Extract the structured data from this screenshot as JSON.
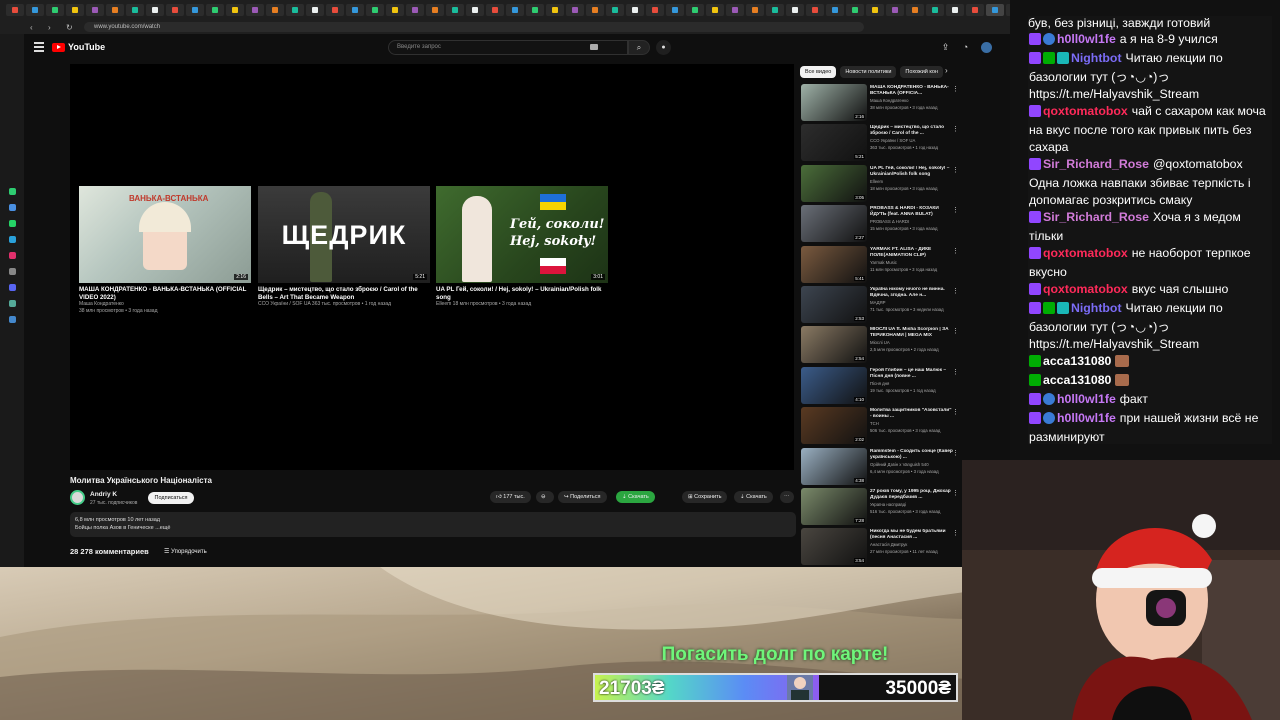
{
  "browser": {
    "url": "www.youtube.com/watch",
    "tab_labels": [
      "HD HO",
      "HD HO",
      "HO HD HO",
      "HD HO",
      "HD HO HD HO"
    ]
  },
  "youtube": {
    "search_placeholder": "Введите запрос",
    "endscreen": [
      {
        "title": "МАША КОНДРАТЕНКО - ВАНЬКА-ВСТАНЬКА (OFFICIAL VIDEO 2022)",
        "channel": "Маша Кондратенко",
        "meta": "38 млн просмотров • 3 года назад",
        "duration": "2:16",
        "thumb_text": "ВАНЬКА-ВСТАНЬКА"
      },
      {
        "title": "Щедрик – мистецтво, що стало зброєю / Carol of the Bells – Art That Became Weapon",
        "channel": "",
        "meta": "ССО України / SOF UA  363 тыс. просмотров • 1 год назад",
        "duration": "5:21",
        "thumb_text": "ЩЕДРИК"
      },
      {
        "title": "UA PL Гей, соколи! / Hej, sokoly! – Ukrainian/Polish folk song",
        "channel": "",
        "meta": "Elleem  18 млн просмотров • 3 года назад",
        "duration": "3:01",
        "thumb_text": "Гей, соколи! Hej, sokoły!"
      }
    ],
    "video_title": "Молитва Українського Націоналіста",
    "channel_name": "Andriy K",
    "channel_subs": "27 тыс. подписчиков",
    "subscribe_label": "Подписаться",
    "likes": "177 тыс.",
    "share_label": "Поделиться",
    "download_promo_label": "Скачать",
    "save_label": "Сохранить",
    "download_label": "Скачать",
    "description_line1": "6,8 млн просмотров  10 лет назад",
    "description_line2": "Бойцы полка Азов в Геническе ...ещё",
    "comments_count": "28 278 комментариев",
    "sort_label": "Упорядочить",
    "chips": [
      "Все видео",
      "Новости политики",
      "Похожий кон"
    ],
    "recommendations": [
      {
        "title": "МАША КОНДРАТЕНКО - ВАНЬКА-ВСТАНЬКА (OFFICIA...",
        "channel": "Маша Кондратенко",
        "meta": "38 млн просмотров • 3 года назад",
        "duration": "2:16"
      },
      {
        "title": "Щедрик – мистецтво, що стало зброєю / Carol of the ...",
        "channel": "ССО України / SOF UA",
        "meta": "363 тыс. просмотров • 1 год назад",
        "duration": "5:21"
      },
      {
        "title": "UA PL Гей, соколи! / Hej, sokoly! – Ukrainian/Polish folk song",
        "channel": "Elleem",
        "meta": "18 млн просмотров • 3 года назад",
        "duration": "3:05"
      },
      {
        "title": "PROBASS & HARDI - КОЗАКИ ЙДУТЬ (feat. ANNA BULAT)",
        "channel": "PROBASS ∆ HARDI",
        "meta": "15 млн просмотров • 3 года назад",
        "duration": "2:27"
      },
      {
        "title": "YARMAK FT. ALISA - ДИКЕ ПОЛЕ(ANIMATION CLIP)",
        "channel": "Yarmak Music",
        "meta": "11 млн просмотров • 3 года назад",
        "duration": "5:41"
      },
      {
        "title": "Україна нікому нічого не винна. Вдячна, згодна. Але н...",
        "channel": "МАДЯР",
        "meta": "71 тыс. просмотров • 3 недели назад",
        "duration": "2:53"
      },
      {
        "title": "МІОСЛІ UA ft. Misha Scorpion | ЗА ТЕРИКОНАМИ | MEGA MIX",
        "channel": "Міослі UA",
        "meta": "2,5 млн просмотров • 2 года назад",
        "duration": "2:54"
      },
      {
        "title": "Герой Глибин – це наш Малюк – Пісня дня (повне ...",
        "channel": "Пісня дня",
        "meta": "19 тыс. просмотров • 1 год назад",
        "duration": "4:10"
      },
      {
        "title": "Молитва защитников \"Азовстали\" - воины ...",
        "channel": "ТСН",
        "meta": "506 тыс. просмотров • 3 года назад",
        "duration": "2:02"
      },
      {
        "title": "Rammstein - Сходить сонце (Кавер українською) ...",
        "channel": "Орійний Дзвін х Vanguish 540",
        "meta": "6,4 млн просмотров • 3 года назад",
        "duration": "4:38"
      },
      {
        "title": "27 років тому, у 1995 році, Джохар Дудаєв передбачив ...",
        "channel": "Україна насправді",
        "meta": "516 тыс. просмотров • 3 года назад",
        "duration": "7:28"
      },
      {
        "title": "Никогда мы не будем братьями (песня Анастасия ...",
        "channel": "Анастасія Дмитрук",
        "meta": "27 млн просмотров • 11 лет назад",
        "duration": "3:54"
      }
    ]
  },
  "chat": {
    "top_line": "був, без різниці, завжди готовий",
    "messages": [
      {
        "user": "h0ll0wl1fe",
        "color": "#c678f5",
        "badges": [
          "sub",
          "glob"
        ],
        "text": "а я на 8-9 учился"
      },
      {
        "user": "Nightbot",
        "color": "#7b6cf6",
        "badges": [
          "sub",
          "mod",
          "vip"
        ],
        "text": "Читаю лекции по базологии тут (っ◔◡◔)っ https://t.me/Halyavshik_Stream"
      },
      {
        "user": "qoxtomatobox",
        "color": "#ff2a5a",
        "badges": [
          "sub"
        ],
        "text": "чай с сахаром как моча на вкус после того как привык пить без сахара"
      },
      {
        "user": "Sir_Richard_Rose",
        "color": "#d17bd8",
        "badges": [
          "sub"
        ],
        "text": "@qoxtomatobox Одна ложка навпаки збиває терпкість і допомагає розкритись смаку"
      },
      {
        "user": "Sir_Richard_Rose",
        "color": "#d17bd8",
        "badges": [
          "sub"
        ],
        "text": "Хоча я з медом тільки"
      },
      {
        "user": "qoxtomatobox",
        "color": "#ff2a5a",
        "badges": [
          "sub"
        ],
        "text": "не наоборот терпкое вкусно"
      },
      {
        "user": "qoxtomatobox",
        "color": "#ff2a5a",
        "badges": [
          "sub"
        ],
        "text": "вкус чая слышно"
      },
      {
        "user": "Nightbot",
        "color": "#7b6cf6",
        "badges": [
          "sub",
          "mod",
          "vip"
        ],
        "text": "Читаю лекции по базологии тут (っ◔◡◔)っ https://t.me/Halyavshik_Stream"
      },
      {
        "user": "acca131080",
        "color": "#ffffff",
        "badges": [
          "kick"
        ],
        "text": "",
        "emote": true
      },
      {
        "user": "acca131080",
        "color": "#ffffff",
        "badges": [
          "kick"
        ],
        "text": "",
        "emote": true
      },
      {
        "user": "h0ll0wl1fe",
        "color": "#c678f5",
        "badges": [
          "sub",
          "glob"
        ],
        "text": "факт"
      },
      {
        "user": "h0ll0wl1fe",
        "color": "#c678f5",
        "badges": [
          "sub",
          "glob"
        ],
        "text": "при нашей жизни всё не разминируют"
      }
    ]
  },
  "goal": {
    "label": "Погасить долг по карте!",
    "current": "21703₴",
    "target": "35000₴",
    "progress": 0.62
  }
}
